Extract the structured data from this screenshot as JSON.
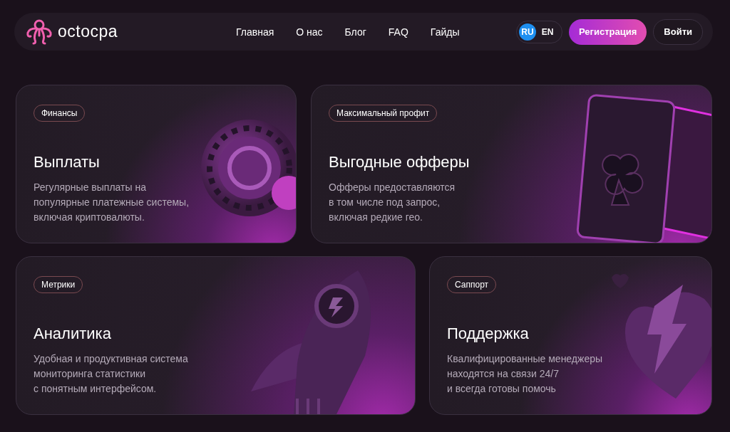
{
  "header": {
    "logo": "octocpa",
    "nav": [
      {
        "label": "Главная"
      },
      {
        "label": "О нас"
      },
      {
        "label": "Блог"
      },
      {
        "label": "FAQ"
      },
      {
        "label": "Гайды"
      }
    ],
    "languages": [
      {
        "label": "RU",
        "selected": true
      },
      {
        "label": "EN",
        "selected": false
      }
    ],
    "register_button": "Регистрация",
    "login_button": "Войти"
  },
  "cards": [
    {
      "kind": "coin",
      "tag": "Финансы",
      "title": "Выплаты",
      "description": "Регулярные выплаты на\nпопулярные платежные системы,\nвключая криптовалюты."
    },
    {
      "kind": "cards",
      "tag": "Максимальный профит",
      "title": "Выгодные офферы",
      "description": "Офферы предоставляются\nв том числе под запрос,\nвключая редкие гео."
    },
    {
      "kind": "rocket",
      "tag": "Метрики",
      "title": "Аналитика",
      "description": "Удобная и продуктивная система\nмониторинга статистики\nс понятным интерфейсом."
    },
    {
      "kind": "heart",
      "tag": "Саппорт",
      "title": "Поддержка",
      "description": "Квалифицированные менеджеры\nнаходятся на связи 24/7\nи всегда готовы помочь"
    }
  ]
}
